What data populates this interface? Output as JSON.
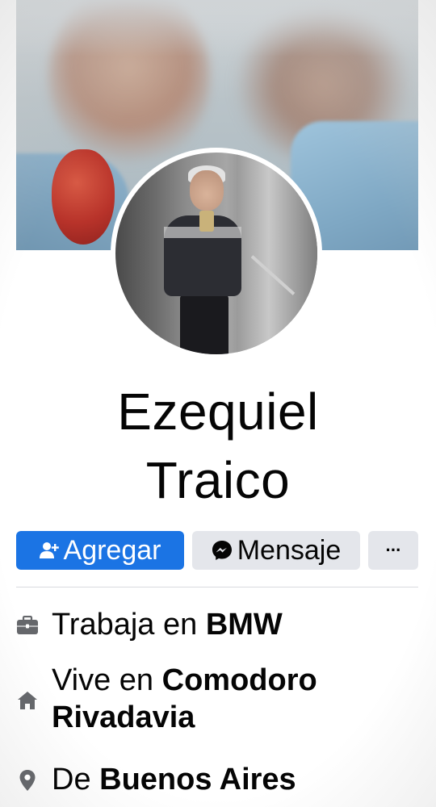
{
  "profile": {
    "first_name": "Ezequiel",
    "last_name": "Traico"
  },
  "actions": {
    "add_label": "Agregar",
    "message_label": "Mensaje",
    "more_label": "···"
  },
  "about": {
    "work_prefix": "Trabaja en",
    "work_value": "BMW",
    "lives_prefix": "Vive en",
    "lives_value_1": "Comodoro",
    "lives_value_2": "Rivadavia",
    "from_prefix": "De",
    "from_value": "Buenos Aires"
  },
  "icons": {
    "add": "add-friend-icon",
    "message": "messenger-icon",
    "work": "briefcase-icon",
    "home": "home-icon",
    "location": "location-pin-icon"
  },
  "colors": {
    "primary": "#1b74e4",
    "secondary_bg": "#e4e6eb",
    "icon_gray": "#65676b",
    "text": "#050505"
  }
}
